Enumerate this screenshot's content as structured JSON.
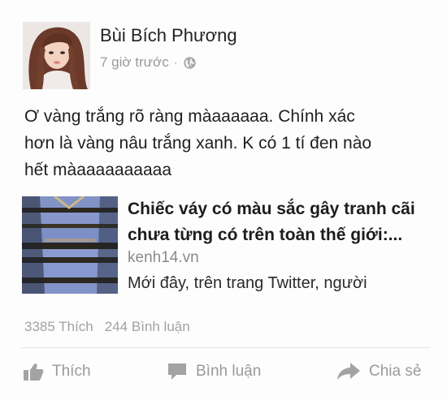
{
  "post": {
    "author": "Bùi Bích Phương",
    "time": "7 giờ trước",
    "meta_separator": "·",
    "privacy_icon": "globe-icon",
    "text_lines": [
      "Ơ vàng trắng rõ ràng màaaaaaa. Chính xác",
      "hơn là vàng nâu trắng xanh. K có 1 tí đen nào",
      "hết màaaaaaaaaaa"
    ]
  },
  "link": {
    "title_lines": [
      "Chiếc váy có màu sắc gây tranh cãi",
      "chưa từng có trên toàn thế giới:..."
    ],
    "domain": "kenh14.vn",
    "description": "Mới đây, trên trang Twitter, người"
  },
  "stats": {
    "likes": "3385 Thích",
    "comments": "244 Bình luận"
  },
  "actions": {
    "like": "Thích",
    "comment": "Bình luận",
    "share": "Chia sẻ"
  },
  "colors": {
    "muted_text": "#9a9a9a",
    "body_text": "#1e1e1e",
    "dress_blue": "#7f93c9",
    "dress_black": "#2a2620"
  }
}
